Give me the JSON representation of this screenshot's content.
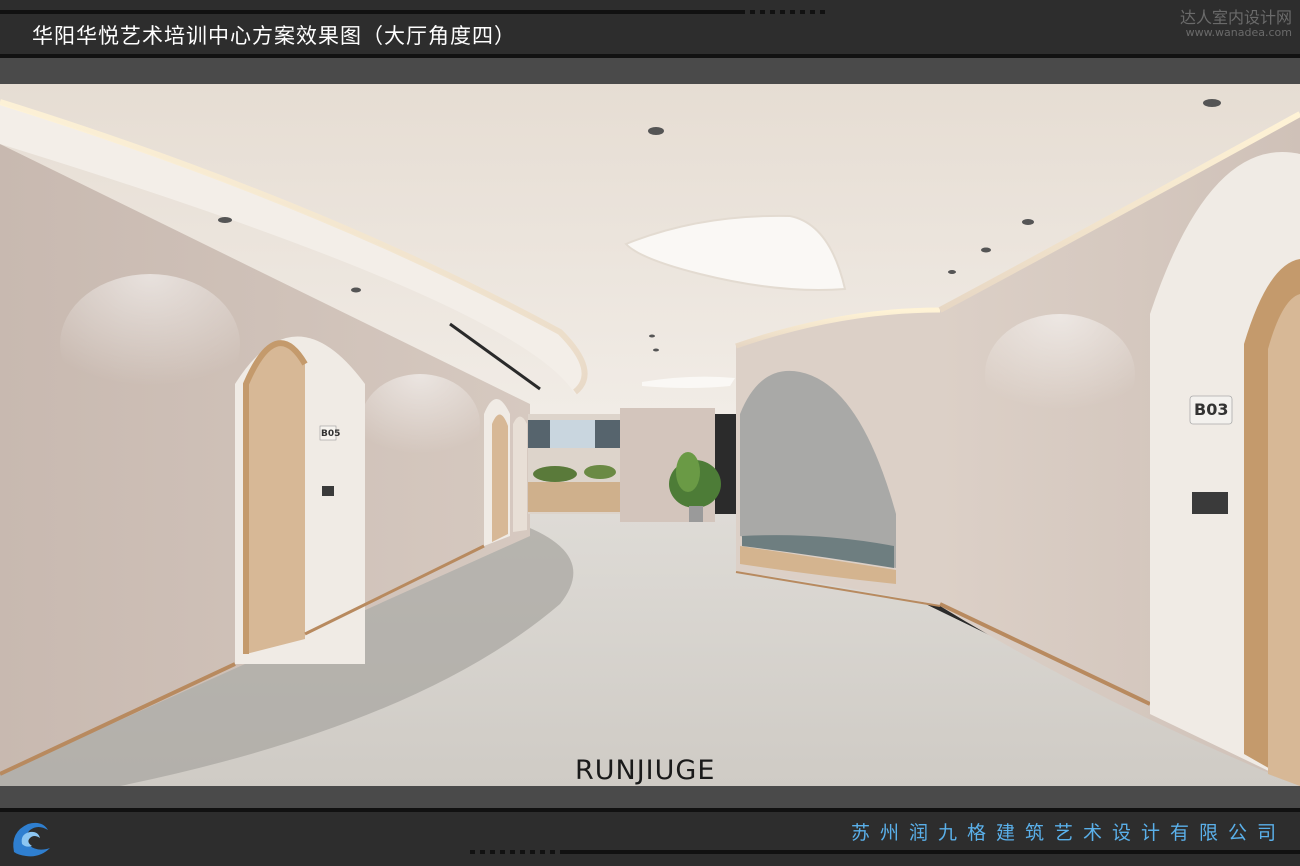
{
  "header": {
    "title": "华阳华悦艺术培训中心方案效果图（大厅角度四）",
    "watermark_cn": "达人室内设计网",
    "watermark_url": "www.wanadea.com"
  },
  "render": {
    "room_sign_left": "B05",
    "room_sign_right": "B03",
    "brand_mark": "RUNJIUGE"
  },
  "footer": {
    "company": "苏州润九格建筑艺术设计有限公司",
    "logo_icon": "swirl-logo-icon"
  },
  "colors": {
    "frame": "#2d2d2d",
    "accent_blue": "#5ab0ea",
    "wall": "#d2c3ba",
    "ceiling": "#ece5dd",
    "floor": "#d8d5d0",
    "wood": "#c9a27a"
  }
}
